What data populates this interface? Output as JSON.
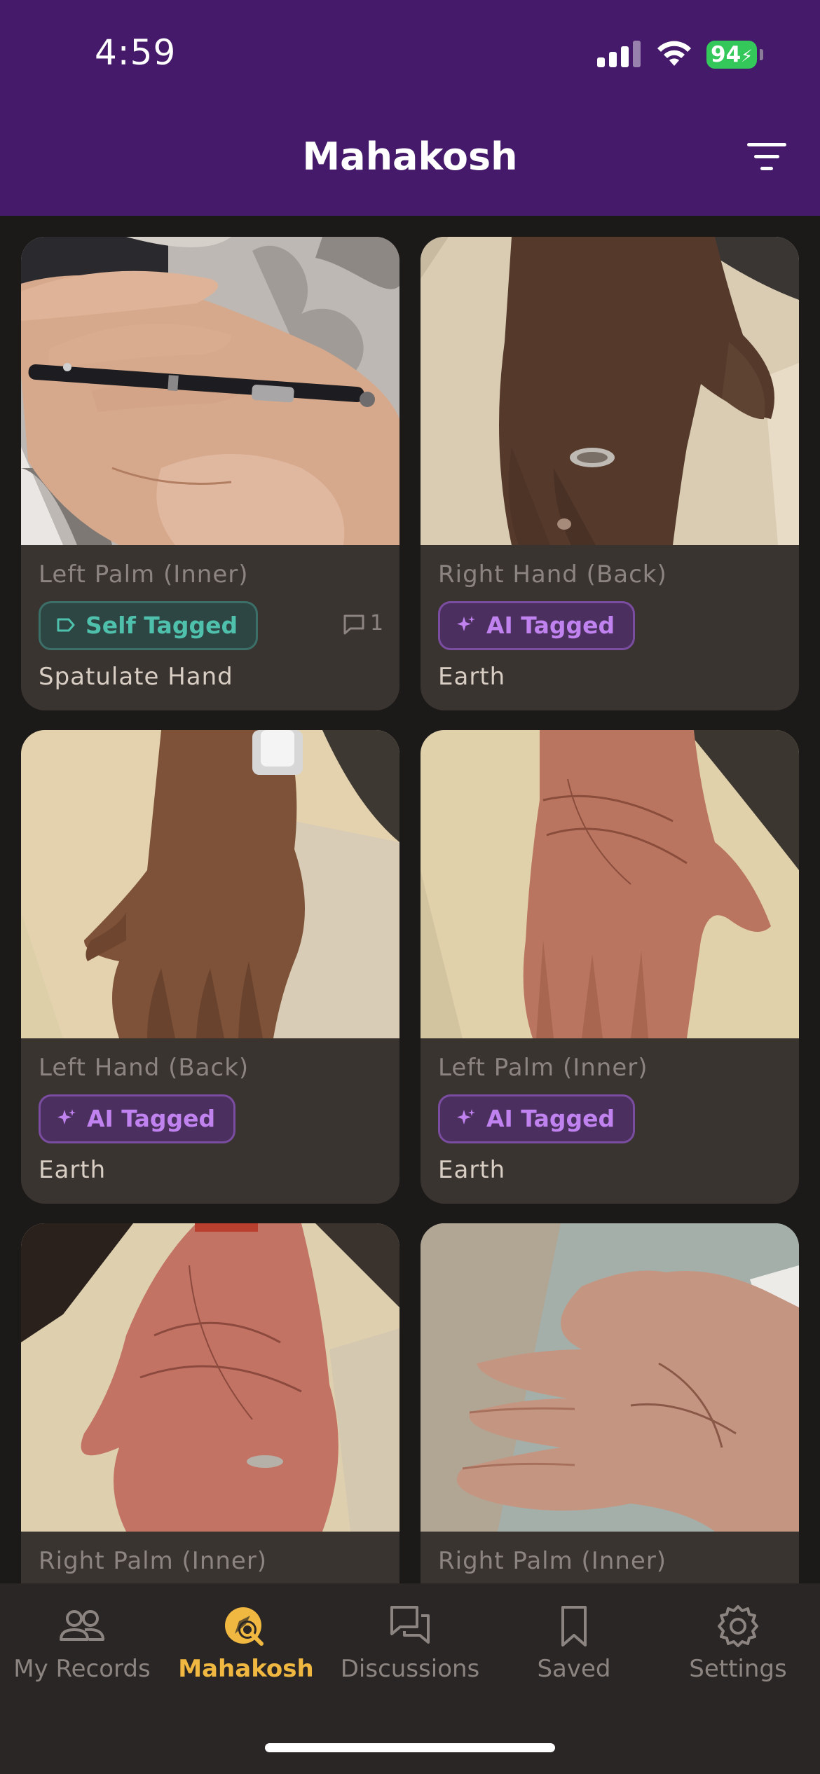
{
  "status_bar": {
    "time": "4:59",
    "battery": "94"
  },
  "header": {
    "title": "Mahakosh",
    "filter_icon": "filter-icon"
  },
  "cards": [
    {
      "title": "Left Palm (Inner)",
      "tag": "Self Tagged",
      "tag_type": "self",
      "comments": "1",
      "subtitle": "Spatulate Hand"
    },
    {
      "title": "Right Hand (Back)",
      "tag": "AI Tagged",
      "tag_type": "ai",
      "subtitle": "Earth"
    },
    {
      "title": "Left Hand (Back)",
      "tag": "AI Tagged",
      "tag_type": "ai",
      "subtitle": "Earth"
    },
    {
      "title": "Left Palm (Inner)",
      "tag": "AI Tagged",
      "tag_type": "ai",
      "subtitle": "Earth"
    },
    {
      "title": "Right Palm (Inner)"
    },
    {
      "title": "Right Palm (Inner)"
    }
  ],
  "nav": [
    {
      "label": "My Records",
      "icon": "users-icon",
      "active": false
    },
    {
      "label": "Mahakosh",
      "icon": "explore-search-icon",
      "active": true
    },
    {
      "label": "Discussions",
      "icon": "chat-bubbles-icon",
      "active": false
    },
    {
      "label": "Saved",
      "icon": "bookmark-icon",
      "active": false
    },
    {
      "label": "Settings",
      "icon": "gear-icon",
      "active": false
    }
  ],
  "colors": {
    "header_bg": "#461a6b",
    "active_nav": "#f0b840",
    "self_tag": "#4ec0ac",
    "ai_tag": "#c082ee"
  }
}
